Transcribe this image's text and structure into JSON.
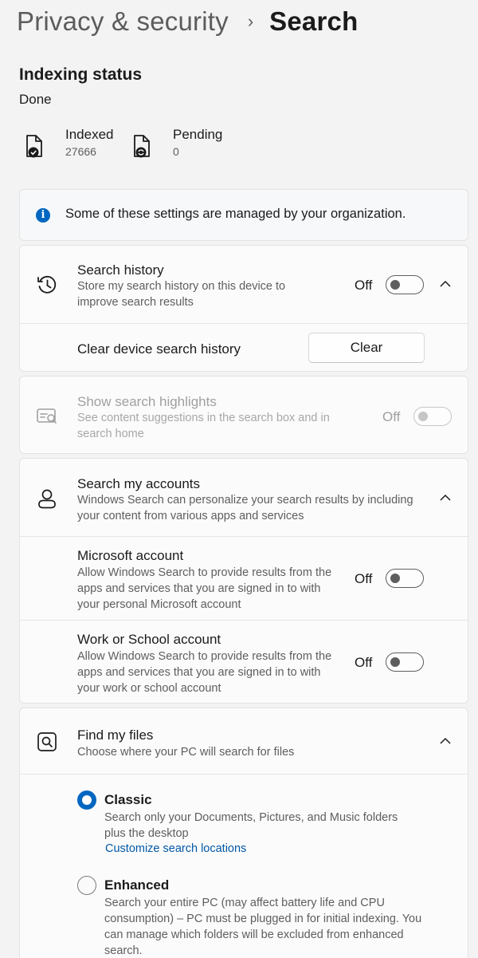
{
  "header": {
    "parent": "Privacy & security",
    "separator": "›",
    "current": "Search"
  },
  "indexing": {
    "title": "Indexing status",
    "state": "Done",
    "indexed": {
      "label": "Indexed",
      "value": "27666",
      "icon": "indexed-file-check-icon"
    },
    "pending": {
      "label": "Pending",
      "value": "0",
      "icon": "pending-file-sync-icon"
    }
  },
  "info_banner": {
    "icon": "info-icon",
    "glyph": "i",
    "text": "Some of these settings are managed by your organization."
  },
  "search_history": {
    "icon": "history-icon",
    "title": "Search history",
    "description": "Store my search history on this device to improve search results",
    "toggle_state": "Off",
    "expanded": true,
    "clear_label": "Clear device search history",
    "clear_button": "Clear"
  },
  "search_highlights": {
    "icon": "search-highlights-icon",
    "title": "Show search highlights",
    "description": "See content suggestions in the search box and in search home",
    "toggle_state": "Off",
    "disabled": true
  },
  "search_accounts": {
    "icon": "person-icon",
    "title": "Search my accounts",
    "description": "Windows Search can personalize your search results by including your content from various apps and services",
    "expanded": true,
    "microsoft": {
      "title": "Microsoft account",
      "description": "Allow Windows Search to provide results from the apps and services that you are signed in to with your personal Microsoft account",
      "toggle_state": "Off"
    },
    "work_school": {
      "title": "Work or School account",
      "description": "Allow Windows Search to provide results from the apps and services that you are signed in to with your work or school account",
      "toggle_state": "Off"
    }
  },
  "find_files": {
    "icon": "find-files-icon",
    "title": "Find my files",
    "description": "Choose where your PC will search for files",
    "expanded": true,
    "classic": {
      "title": "Classic",
      "description": "Search only your Documents, Pictures, and Music folders plus the desktop",
      "link": "Customize search locations",
      "selected": true
    },
    "enhanced": {
      "title": "Enhanced",
      "description": "Search your entire PC (may affect battery life and CPU consumption) – PC must be plugged in for initial indexing. You can manage which folders will be excluded from enhanced search.",
      "selected": false
    }
  },
  "colors": {
    "accent": "#0067c0",
    "link": "#0058a8",
    "background": "#f3f3f3",
    "card": "#fbfbfb"
  }
}
